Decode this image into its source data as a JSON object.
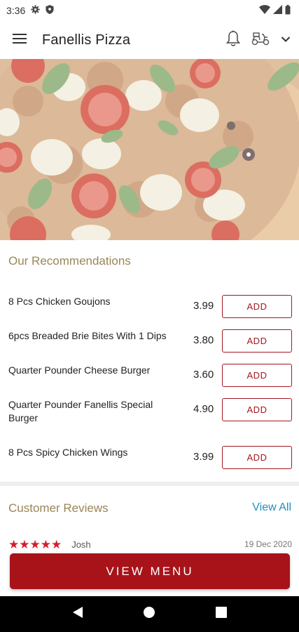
{
  "status_bar": {
    "time": "3:36",
    "icons": [
      "gear-icon",
      "shield-icon",
      "wifi-icon",
      "signal-icon",
      "battery-icon"
    ]
  },
  "app_bar": {
    "title": "Fanellis Pizza",
    "icons": [
      "menu-icon",
      "bell-icon",
      "delivery-scooter-icon",
      "chevron-down-icon"
    ]
  },
  "hero": {
    "description_icon": "pizza-banner"
  },
  "recommendations": {
    "title": "Our Recommendations",
    "add_label": "ADD",
    "items": [
      {
        "name": "8 Pcs Chicken Goujons",
        "price": "3.99"
      },
      {
        "name": "6pcs Breaded Brie Bites With 1 Dips",
        "price": "3.80"
      },
      {
        "name": "Quarter Pounder Cheese Burger",
        "price": "3.60"
      },
      {
        "name": "Quarter Pounder Fanellis Special Burger",
        "price": "4.90"
      },
      {
        "name": "8 Pcs Spicy Chicken Wings",
        "price": "3.99"
      }
    ]
  },
  "reviews": {
    "title": "Customer Reviews",
    "view_all_label": "View All",
    "first_review": {
      "rating": 5,
      "stars": "★★★★★",
      "author": "Josh",
      "date": "19 Dec 2020"
    }
  },
  "cta": {
    "label": "VIEW MENU",
    "color": "#a8131a"
  },
  "colors": {
    "accent": "#a01820",
    "section_title": "#9a8658",
    "link": "#1f8fbf"
  },
  "nav_bar": {
    "icons": [
      "back-icon",
      "home-icon",
      "recents-icon"
    ]
  }
}
